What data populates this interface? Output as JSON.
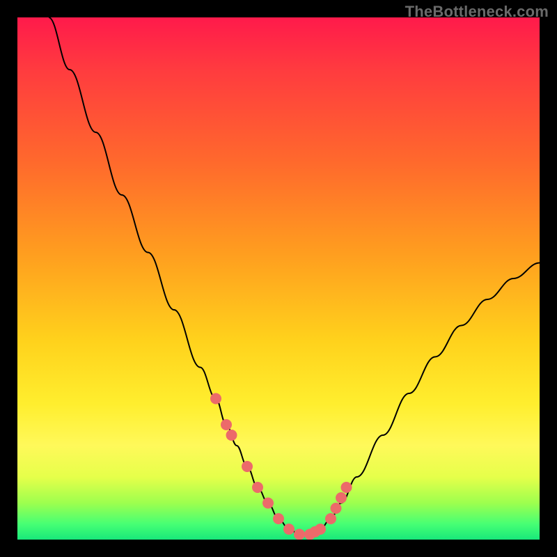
{
  "watermark": "TheBottleneck.com",
  "chart_data": {
    "type": "line",
    "title": "",
    "xlabel": "",
    "ylabel": "",
    "xlim": [
      0,
      100
    ],
    "ylim": [
      0,
      100
    ],
    "grid": false,
    "legend": false,
    "series": [
      {
        "name": "bottleneck-curve",
        "x": [
          6,
          10,
          15,
          20,
          25,
          30,
          35,
          38,
          40,
          42,
          44,
          46,
          48,
          50,
          52,
          54,
          56,
          58,
          60,
          62,
          65,
          70,
          75,
          80,
          85,
          90,
          95,
          100
        ],
        "y": [
          100,
          90,
          78,
          66,
          55,
          44,
          33,
          27,
          22,
          18,
          14,
          10,
          7,
          4,
          2,
          1,
          1,
          2,
          4,
          7,
          12,
          20,
          28,
          35,
          41,
          46,
          50,
          53
        ]
      }
    ],
    "markers": [
      {
        "name": "highlight-beads",
        "x": [
          38,
          40,
          41,
          44,
          46,
          48,
          50,
          52,
          54,
          56,
          57,
          58,
          60,
          61,
          62,
          63
        ],
        "y": [
          27,
          22,
          20,
          14,
          10,
          7,
          4,
          2,
          1,
          1,
          1.5,
          2,
          4,
          6,
          8,
          10
        ]
      }
    ],
    "background_gradient": {
      "top": "#ff1a4b",
      "mid": "#ffd21c",
      "bottom": "#18e87a"
    }
  }
}
